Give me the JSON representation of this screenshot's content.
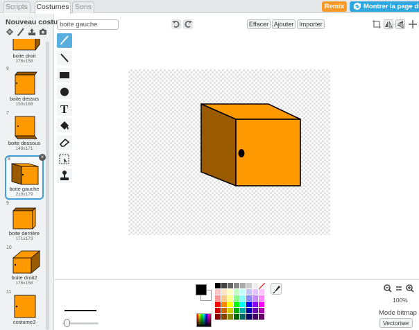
{
  "tabs": [
    {
      "label": "Scripts",
      "active": false
    },
    {
      "label": "Costumes",
      "active": true
    },
    {
      "label": "Sons",
      "active": false
    }
  ],
  "header": {
    "remix_label": "Remix",
    "project_page_label": "Montrer la page du p"
  },
  "left_panel": {
    "new_costume_label": "Nouveau costume:",
    "new_costume_icons": [
      "paint-from-library-icon",
      "paint-brush-icon",
      "upload-icon",
      "camera-icon"
    ],
    "costumes": [
      {
        "number": "",
        "name": "boite droit",
        "size": "176x158",
        "selected": false
      },
      {
        "number": "6",
        "name": "boite dessus",
        "size": "150x188",
        "selected": false
      },
      {
        "number": "7",
        "name": "boite dessous",
        "size": "149x171",
        "selected": false
      },
      {
        "number": "8",
        "name": "boite gauche",
        "size": "219x179",
        "selected": true
      },
      {
        "number": "9",
        "name": "boite derrière",
        "size": "171x173",
        "selected": false
      },
      {
        "number": "10",
        "name": "boite droit2",
        "size": "176x158",
        "selected": false
      },
      {
        "number": "11",
        "name": "costume3",
        "size": "",
        "selected": false
      }
    ]
  },
  "editor": {
    "costume_name_value": "boite gauche",
    "clear_label": "Effacer",
    "add_label": "Ajouter",
    "import_label": "Importer",
    "zoom_level": "100%",
    "mode_label": "Mode bitmap",
    "vectorize_label": "Vectoriser"
  },
  "tools": [
    "brush-icon",
    "line-icon",
    "rectangle-icon",
    "ellipse-icon",
    "text-icon",
    "fill-icon",
    "eraser-icon",
    "select-icon",
    "stamp-icon"
  ],
  "colors": {
    "accent": "#3f9fd6",
    "remix": "#f79a27",
    "project_button": "#2fa8e1",
    "box_front": "#ff9900",
    "box_side": "#9a5a00",
    "palette": [
      "#000000",
      "#444444",
      "#666666",
      "#888888",
      "#aaaaaa",
      "#cccccc",
      "#eeeeee",
      "#ffffff",
      "#ffc4c4",
      "#ffe4c4",
      "#ffffc4",
      "#c4ffc4",
      "#c4ffff",
      "#c4c4ff",
      "#e4c4ff",
      "#ffc4ff",
      "#ff9a9a",
      "#ffc88a",
      "#ffff8a",
      "#8aff8a",
      "#8affff",
      "#8a8aff",
      "#c88aff",
      "#ff8aff",
      "#ff0000",
      "#ff8800",
      "#ffff00",
      "#00ff00",
      "#00ffff",
      "#0000ff",
      "#8800ff",
      "#ff00ff",
      "#cc0000",
      "#cc6600",
      "#cccc00",
      "#00aa00",
      "#00aaaa",
      "#0000aa",
      "#6600aa",
      "#aa00aa",
      "#880000",
      "#884400",
      "#888800",
      "#006600",
      "#006666",
      "#000066",
      "#440066",
      "#660066"
    ]
  }
}
